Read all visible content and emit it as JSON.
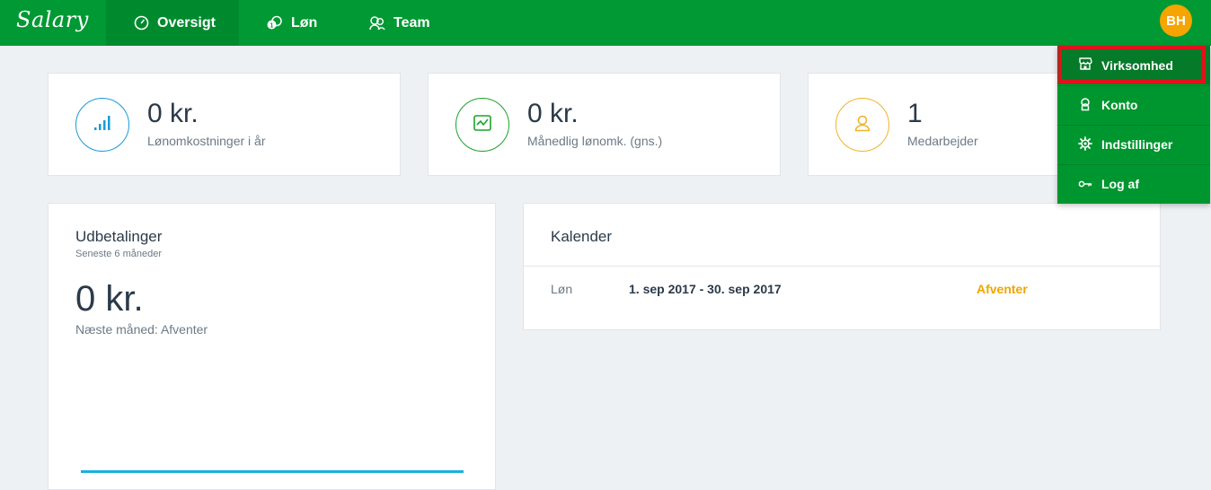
{
  "app": {
    "logo": "Salary"
  },
  "nav": {
    "items": [
      {
        "label": "Oversigt",
        "icon": "gauge-icon",
        "active": true
      },
      {
        "label": "Løn",
        "icon": "coins-icon",
        "active": false
      },
      {
        "label": "Team",
        "icon": "team-icon",
        "active": false
      }
    ]
  },
  "user": {
    "initials": "BH"
  },
  "stats": [
    {
      "value": "0 kr.",
      "label": "Lønomkostninger i år",
      "icon": "signal-bars-icon",
      "color": "#1a9bd7"
    },
    {
      "value": "0 kr.",
      "label": "Månedlig lønomk. (gns.)",
      "icon": "chart-icon",
      "color": "#1aa32a"
    },
    {
      "value": "1",
      "label": "Medarbejder",
      "icon": "user-icon",
      "color": "#f0b429"
    }
  ],
  "payouts": {
    "title": "Udbetalinger",
    "subtitle": "Seneste 6 måneder",
    "value": "0 kr.",
    "next": "Næste måned: Afventer",
    "line_color": "#1ab0e0"
  },
  "calendar": {
    "title": "Kalender",
    "rows": [
      {
        "type": "Løn",
        "period": "1. sep 2017 - 30. sep 2017",
        "status": "Afventer",
        "status_color": "#f0a500"
      }
    ]
  },
  "menu": {
    "items": [
      {
        "label": "Virksomhed",
        "icon": "store-icon",
        "highlighted": true
      },
      {
        "label": "Konto",
        "icon": "account-icon",
        "highlighted": false
      },
      {
        "label": "Indstillinger",
        "icon": "gear-icon",
        "highlighted": false
      },
      {
        "label": "Log af",
        "icon": "key-icon",
        "highlighted": false
      }
    ]
  }
}
